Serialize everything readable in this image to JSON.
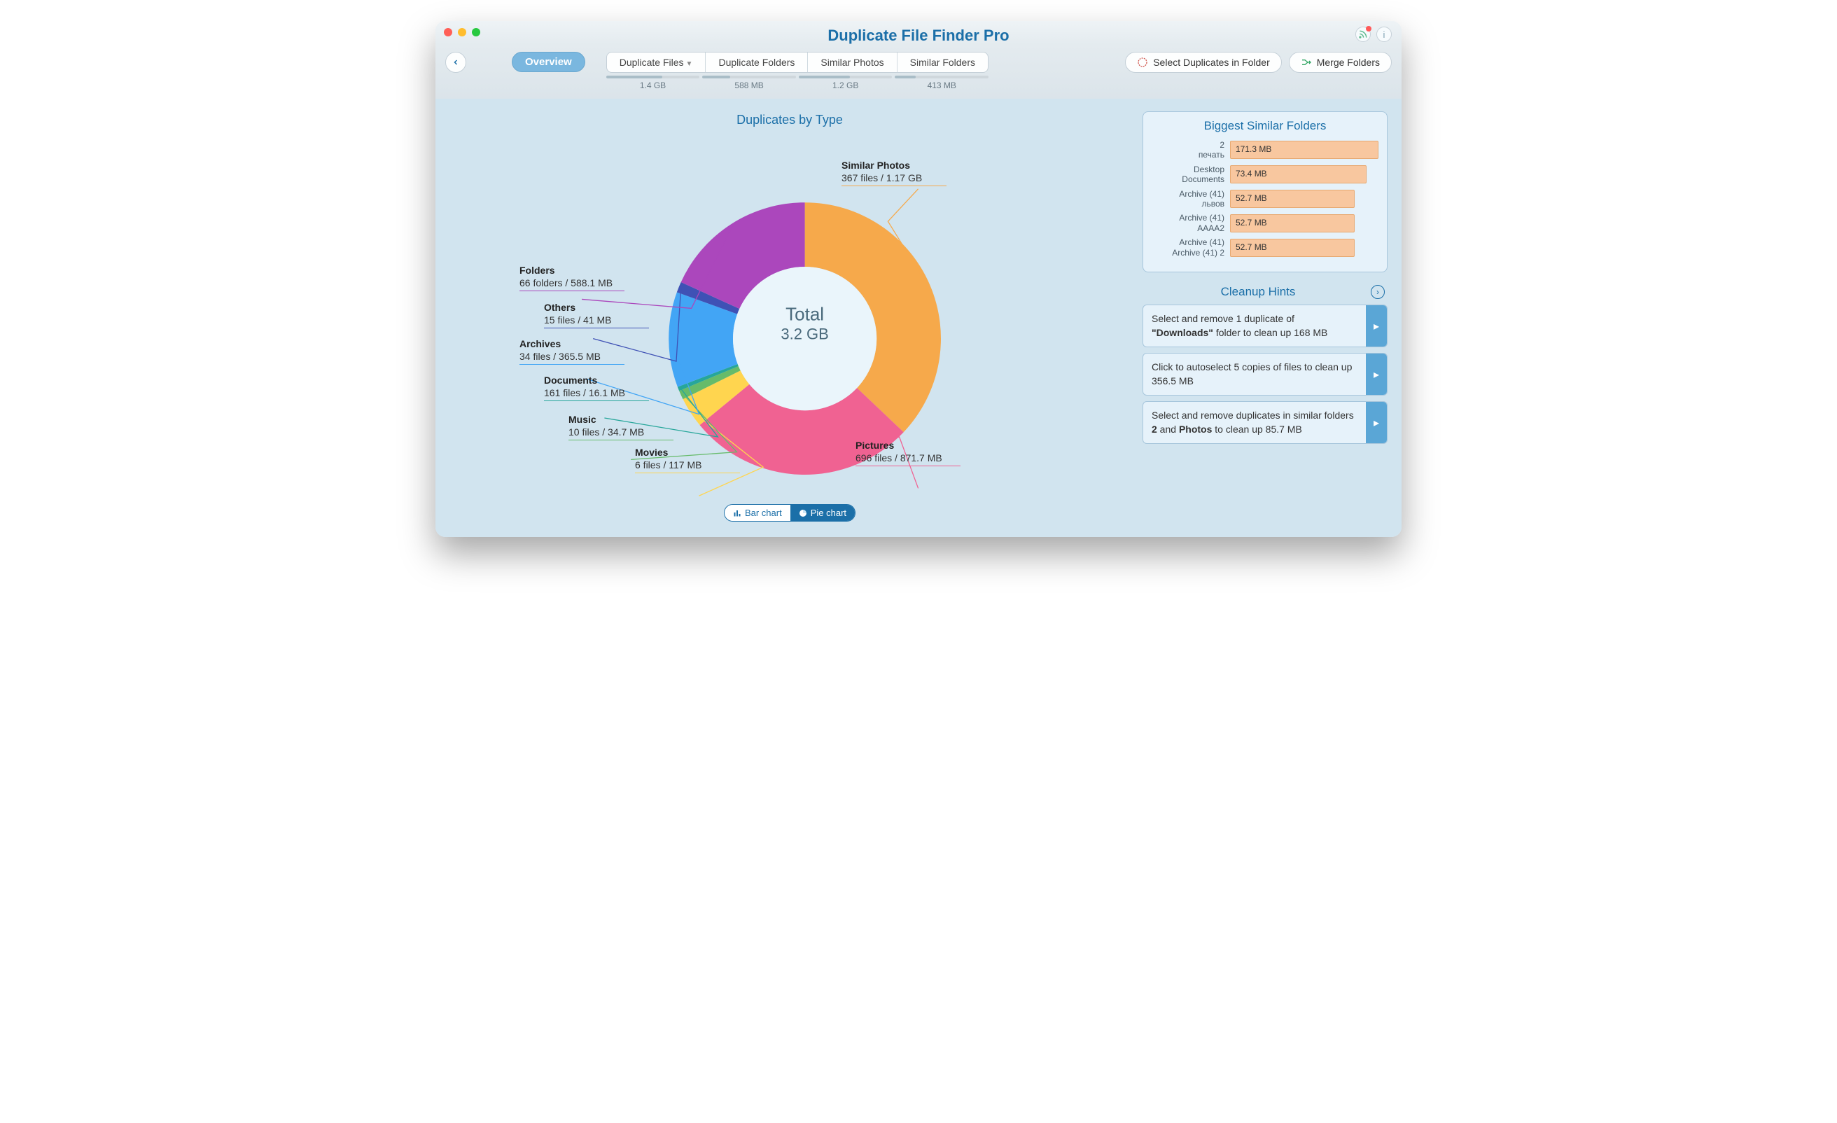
{
  "window": {
    "title": "Duplicate File Finder Pro"
  },
  "toolbar": {
    "overview": "Overview",
    "tabs": [
      {
        "label": "Duplicate Files",
        "size": "1.4 GB",
        "fill": 60,
        "dropdown": true
      },
      {
        "label": "Duplicate Folders",
        "size": "588 MB",
        "fill": 30,
        "dropdown": false
      },
      {
        "label": "Similar Photos",
        "size": "1.2 GB",
        "fill": 55,
        "dropdown": false
      },
      {
        "label": "Similar Folders",
        "size": "413 MB",
        "fill": 22,
        "dropdown": false
      }
    ],
    "select_duplicates": "Select Duplicates in Folder",
    "merge_folders": "Merge Folders"
  },
  "chart": {
    "title": "Duplicates by Type",
    "center_label": "Total",
    "center_value": "3.2 GB",
    "toggle": {
      "bar": "Bar chart",
      "pie": "Pie chart",
      "active": "pie"
    },
    "slices": [
      {
        "name": "Similar Photos",
        "detail": "367 files / 1.17 GB",
        "color": "#f6a94b"
      },
      {
        "name": "Pictures",
        "detail": "696 files / 871.7 MB",
        "color": "#f06292"
      },
      {
        "name": "Movies",
        "detail": "6 files / 117 MB",
        "color": "#ffd54f"
      },
      {
        "name": "Music",
        "detail": "10 files / 34.7 MB",
        "color": "#66bb6a"
      },
      {
        "name": "Documents",
        "detail": "161 files / 16.1 MB",
        "color": "#26a69a"
      },
      {
        "name": "Archives",
        "detail": "34 files / 365.5 MB",
        "color": "#42a5f5"
      },
      {
        "name": "Others",
        "detail": "15 files / 41 MB",
        "color": "#3f51b5"
      },
      {
        "name": "Folders",
        "detail": "66 folders / 588.1 MB",
        "color": "#ab47bc"
      }
    ]
  },
  "chart_data": {
    "type": "pie",
    "title": "Duplicates by Type",
    "total_label": "Total",
    "total_value": "3.2 GB",
    "series": [
      {
        "name": "Similar Photos",
        "value_mb": 1198,
        "count": 367,
        "unit": "files",
        "display": "1.17 GB",
        "color": "#f6a94b"
      },
      {
        "name": "Pictures",
        "value_mb": 871.7,
        "count": 696,
        "unit": "files",
        "display": "871.7 MB",
        "color": "#f06292"
      },
      {
        "name": "Movies",
        "value_mb": 117,
        "count": 6,
        "unit": "files",
        "display": "117 MB",
        "color": "#ffd54f"
      },
      {
        "name": "Music",
        "value_mb": 34.7,
        "count": 10,
        "unit": "files",
        "display": "34.7 MB",
        "color": "#66bb6a"
      },
      {
        "name": "Documents",
        "value_mb": 16.1,
        "count": 161,
        "unit": "files",
        "display": "16.1 MB",
        "color": "#26a69a"
      },
      {
        "name": "Archives",
        "value_mb": 365.5,
        "count": 34,
        "unit": "files",
        "display": "365.5 MB",
        "color": "#42a5f5"
      },
      {
        "name": "Others",
        "value_mb": 41,
        "count": 15,
        "unit": "files",
        "display": "41 MB",
        "color": "#3f51b5"
      },
      {
        "name": "Folders",
        "value_mb": 588.1,
        "count": 66,
        "unit": "folders",
        "display": "588.1 MB",
        "color": "#ab47bc"
      }
    ]
  },
  "biggest_similar": {
    "title": "Biggest Similar Folders",
    "rows": [
      {
        "name1": "2",
        "name2": "печать",
        "size": "171.3 MB",
        "pct": 100
      },
      {
        "name1": "Desktop",
        "name2": "Documents",
        "size": "73.4 MB",
        "pct": 92
      },
      {
        "name1": "Archive (41)",
        "name2": "львов",
        "size": "52.7 MB",
        "pct": 84
      },
      {
        "name1": "Archive (41)",
        "name2": "AAAA2",
        "size": "52.7 MB",
        "pct": 84
      },
      {
        "name1": "Archive (41)",
        "name2": "Archive (41) 2",
        "size": "52.7 MB",
        "pct": 84
      }
    ]
  },
  "hints": {
    "title": "Cleanup Hints",
    "items": [
      {
        "html": "Select and remove 1 duplicate of <b>\"Downloads\"</b> folder to clean up 168 MB"
      },
      {
        "html": "Click to autoselect 5 copies of files to clean up 356.5 MB"
      },
      {
        "html": "Select and remove duplicates in similar folders <b>2</b> and <b>Photos</b> to clean up 85.7 MB"
      }
    ]
  }
}
